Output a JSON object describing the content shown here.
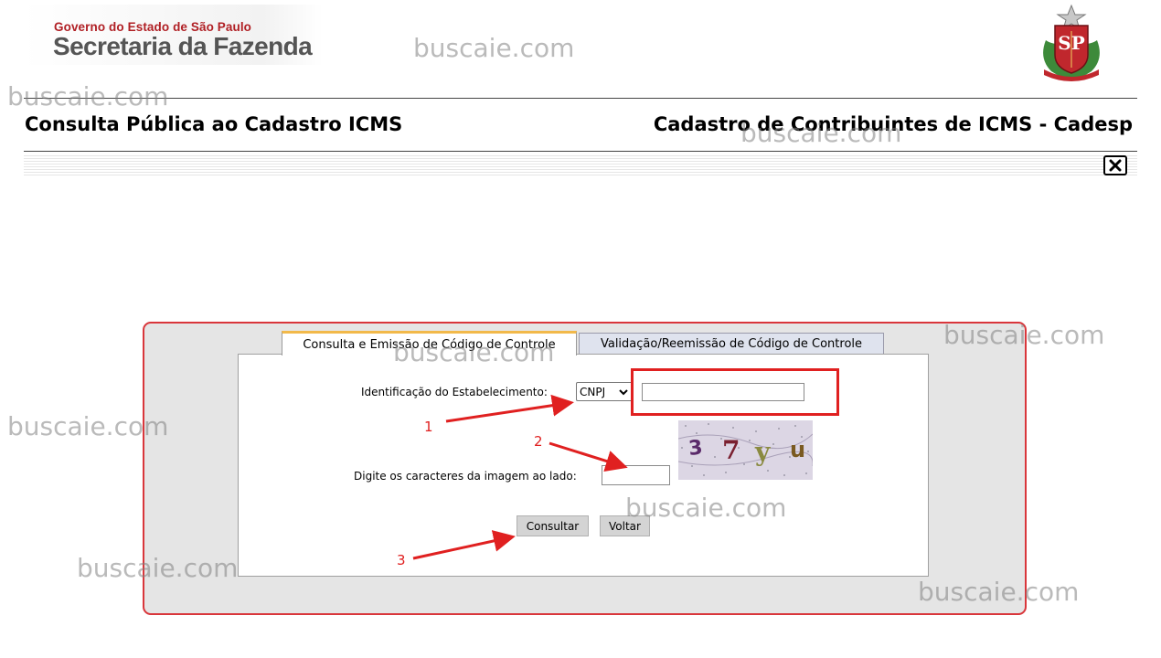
{
  "header": {
    "gov_line": "Governo do Estado de São Paulo",
    "secretaria": "Secretaria da Fazenda",
    "crest_letters": "SP",
    "crest_icon": "sao-paulo-coat-of-arms"
  },
  "titles": {
    "left": "Consulta Pública ao Cadastro ICMS",
    "right": "Cadastro de Contribuintes de ICMS - Cadesp"
  },
  "close_icon": "close-x-icon",
  "tabs": [
    {
      "label": "Consulta e Emissão de Código de Controle",
      "active": true
    },
    {
      "label": "Validação/Reemissão de Código de Controle",
      "active": false
    }
  ],
  "form": {
    "id_label": "Identificação do Estabelecimento:",
    "id_type_selected": "CNPJ",
    "id_value": "",
    "captcha_label": "Digite os caracteres da imagem ao lado:",
    "captcha_value": "",
    "captcha_chars": [
      "3",
      "7",
      "y",
      "u"
    ],
    "consultar_label": "Consultar",
    "voltar_label": "Voltar"
  },
  "annotations": {
    "step1": "1",
    "step2": "2",
    "step3": "3",
    "color": "#e02020"
  },
  "watermarks": [
    "buscaie.com",
    "buscaie.com",
    "buscaie.com",
    "buscaie.com",
    "buscaie.com",
    "buscaie.com",
    "buscaie.com",
    "buscaie.com",
    "buscaie.com"
  ]
}
